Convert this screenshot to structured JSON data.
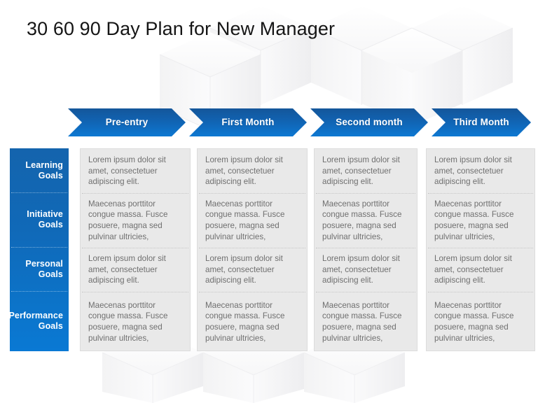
{
  "slide": {
    "title": "30 60 90 Day Plan for New Manager",
    "background": "faint-isometric-cubes",
    "colors": {
      "arrow_blue_top": "#13599d",
      "arrow_blue_bottom": "#0d76cf",
      "sidebar_blue_top": "#1464ad",
      "sidebar_blue_bottom": "#0a79d4",
      "cell_bg": "#e9e9e9",
      "cell_text": "#6f6f6f",
      "title_text": "#151515"
    }
  },
  "columns": [
    {
      "label": "Pre-entry"
    },
    {
      "label": "First Month"
    },
    {
      "label": "Second month"
    },
    {
      "label": "Third Month"
    }
  ],
  "rows": [
    {
      "label_lines": [
        "Learning",
        "Goals"
      ]
    },
    {
      "label_lines": [
        "Initiative",
        "Goals"
      ]
    },
    {
      "label_lines": [
        "Personal",
        "Goals"
      ]
    },
    {
      "label_lines": [
        "Performance",
        "Goals"
      ]
    }
  ],
  "body_variants": {
    "lorem": [
      "Lorem ipsum dolor sit",
      "amet, consectetuer",
      "adipiscing elit."
    ],
    "maecenas": [
      " Maecenas porttitor",
      "congue massa. Fusce",
      "posuere, magna sed",
      "pulvinar ultricies,"
    ]
  },
  "cells": [
    [
      [
        "Lorem ipsum dolor sit",
        "amet, consectetuer",
        "adipiscing elit."
      ],
      [
        "Lorem ipsum dolor sit",
        "amet, consectetuer",
        "adipiscing elit."
      ],
      [
        "Lorem ipsum dolor sit",
        "amet, consectetuer",
        "adipiscing elit."
      ],
      [
        "Lorem ipsum dolor sit",
        "amet, consectetuer",
        "adipiscing elit."
      ]
    ],
    [
      [
        " Maecenas porttitor",
        "congue massa. Fusce",
        "posuere, magna sed",
        "pulvinar ultricies,"
      ],
      [
        " Maecenas porttitor",
        "congue massa. Fusce",
        "posuere, magna sed",
        "pulvinar ultricies,"
      ],
      [
        " Maecenas porttitor",
        "congue massa. Fusce",
        "posuere, magna sed",
        "pulvinar ultricies,"
      ],
      [
        " Maecenas porttitor",
        "congue massa. Fusce",
        "posuere, magna sed",
        "pulvinar ultricies,"
      ]
    ],
    [
      [
        "Lorem ipsum dolor sit",
        "amet, consectetuer",
        "adipiscing elit."
      ],
      [
        "Lorem ipsum dolor sit",
        "amet, consectetuer",
        "adipiscing elit."
      ],
      [
        "Lorem ipsum dolor sit",
        "amet, consectetuer",
        "adipiscing elit."
      ],
      [
        "Lorem ipsum dolor sit",
        "amet, consectetuer",
        "adipiscing elit."
      ]
    ],
    [
      [
        " Maecenas porttitor",
        "congue massa. Fusce",
        "posuere, magna sed",
        "pulvinar ultricies,"
      ],
      [
        " Maecenas porttitor",
        "congue massa. Fusce",
        "posuere, magna sed",
        "pulvinar ultricies,"
      ],
      [
        " Maecenas porttitor",
        "congue massa. Fusce",
        "posuere, magna sed",
        "pulvinar ultricies,"
      ],
      [
        " Maecenas porttitor",
        "congue massa. Fusce",
        "posuere, magna sed",
        "pulvinar ultricies,"
      ]
    ]
  ]
}
